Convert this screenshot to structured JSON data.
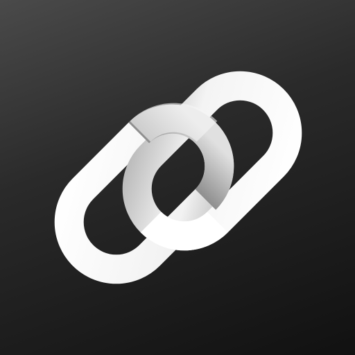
{
  "icon": {
    "name": "chain-link-icon",
    "colors": {
      "background_top": "#4a4a4a",
      "background_bottom": "#111111",
      "link_light": "#ffffff",
      "link_shadow": "#9a9a9a"
    }
  }
}
